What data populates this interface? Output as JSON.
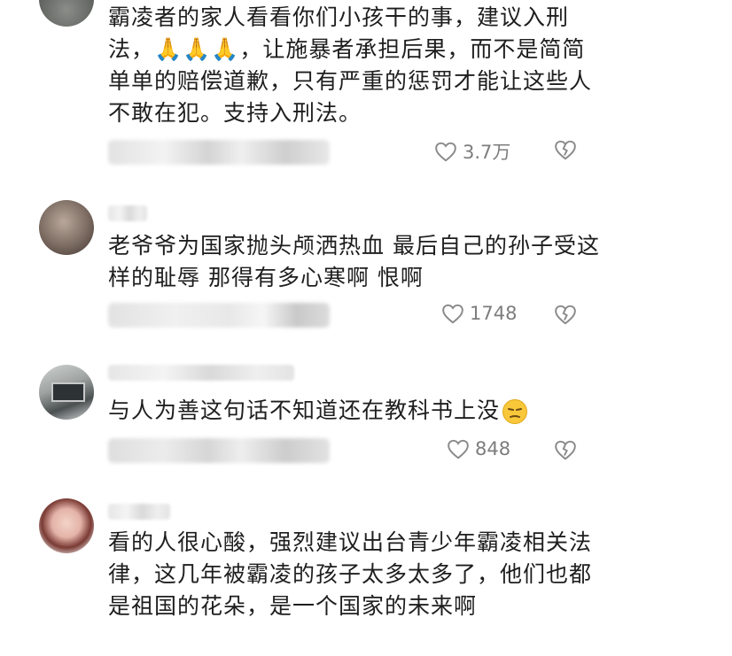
{
  "comments": [
    {
      "text": "霸凌者的家人看看你们小孩干的事，建议入刑法，🙏🙏🙏，让施暴者承担后果，而不是简简单单的赔偿道歉，只有严重的惩罚才能让这些人不敢在犯。支持入刑法。",
      "likes": "3.7万",
      "avatar_icon": "avatar-grey-landscape"
    },
    {
      "text": "老爷爷为国家抛头颅洒热血  最后自己的孙子受这样的耻辱  那得有多心寒啊  恨啊",
      "likes": "1748",
      "avatar_icon": "avatar-face-closeup"
    },
    {
      "text": "与人为善这句话不知道还在教科书上没",
      "likes": "848",
      "emoji": "😒",
      "avatar_icon": "avatar-kitchen-stove"
    },
    {
      "text": "看的人很心酸，强烈建议出台青少年霸凌相关法律，这几年被霸凌的孩子太多太多了，他们也都是祖国的花朵，是一个国家的未来啊",
      "avatar_icon": "avatar-girl-portrait"
    }
  ],
  "icons": {
    "like": "heart-outline-icon",
    "dislike": "broken-heart-icon"
  },
  "colors": {
    "text": "#1e1e1e",
    "meta": "#7d7d7d",
    "background": "#ffffff"
  }
}
